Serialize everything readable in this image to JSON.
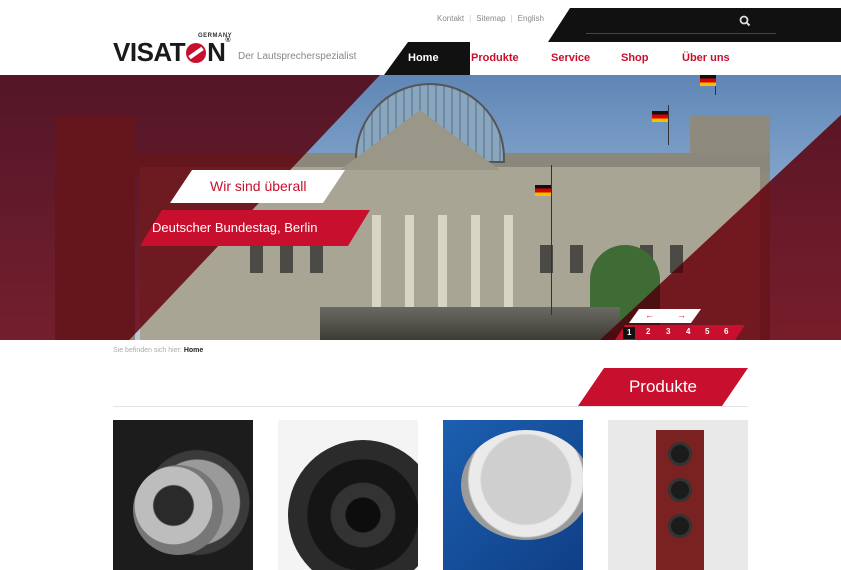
{
  "utility_links": [
    "Kontakt",
    "Sitemap",
    "English"
  ],
  "search": {
    "placeholder": ""
  },
  "brand": {
    "germany": "GERMANY",
    "name_left": "VISAT",
    "name_right": "N",
    "registered": "®",
    "tagline": "Der Lautsprecherspezialist"
  },
  "nav": {
    "home": "Home",
    "produkte": "Produkte",
    "service": "Service",
    "shop": "Shop",
    "ueber_uns": "Über uns"
  },
  "hero": {
    "tag_top": "Wir sind überall",
    "tag_bottom": "Deutscher Bundestag, Berlin",
    "prev_arrow": "←",
    "next_arrow": "→",
    "pages": [
      "1",
      "2",
      "3",
      "4",
      "5",
      "6"
    ],
    "current_page": "1"
  },
  "breadcrumb": {
    "prefix": "Sie befinden sich hier:",
    "current": "Home"
  },
  "products": {
    "heading": "Produkte"
  },
  "colors": {
    "brand_red": "#c8102e",
    "black": "#111111"
  }
}
